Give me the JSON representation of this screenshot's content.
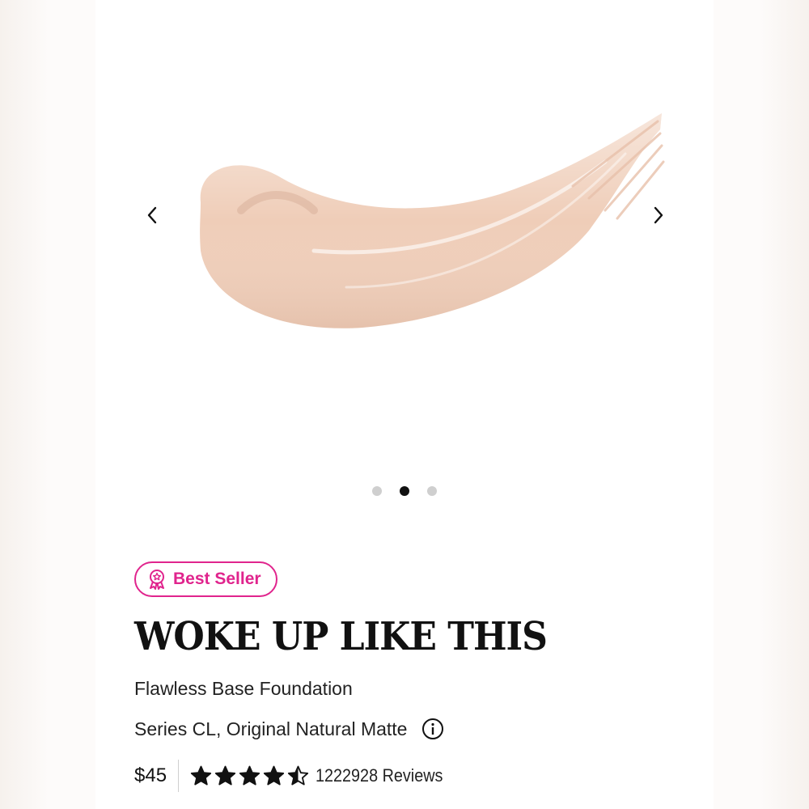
{
  "carousel": {
    "image_alt": "foundation swatch",
    "slide_count": 3,
    "active_slide": 2,
    "swatch_color": "#efcdb8"
  },
  "product": {
    "badge_label": "Best Seller",
    "brand": "WOKE UP LIKE THIS",
    "name": "Flawless Base Foundation",
    "shade": "Series CL, Original Natural Matte",
    "price": "$45",
    "rating": 4.5,
    "reviews_label": "1222928 Reviews"
  },
  "colors": {
    "accent": "#e0248d",
    "text": "#111111",
    "dot_inactive": "#cfcfcf",
    "dot_active": "#111111"
  },
  "icons": {
    "prev": "chevron-left-icon",
    "next": "chevron-right-icon",
    "badge": "award-ribbon-icon",
    "info": "info-icon",
    "star": "star-icon"
  }
}
